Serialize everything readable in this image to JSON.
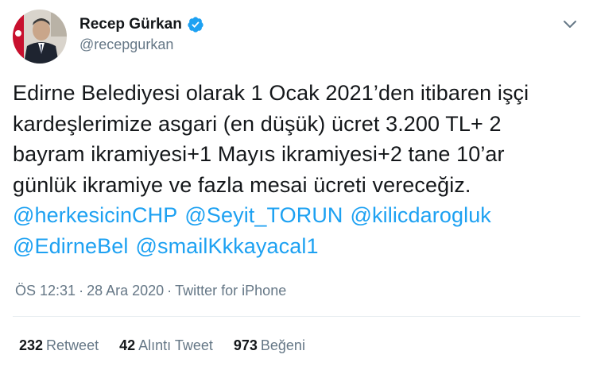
{
  "author": {
    "display_name": "Recep Gürkan",
    "handle": "@recepgurkan",
    "verified": true,
    "verified_color": "#1da1f2"
  },
  "tweet": {
    "lines": [
      "Edirne Belediyesi olarak 1 Ocak 2021’den itibaren işçi",
      "kardeşlerimize asgari (en düşük) ücret 3.200 TL+ 2",
      "bayram ikramiyesi+1 Mayıs ikramiyesi+2 tane 10’ar",
      "günlük ikramiye ve fazla mesai ücreti vereceğiz."
    ],
    "mentions_line1": [
      "@herkesicinCHP",
      "@Seyit_TORUN",
      "@kilicdarogluk"
    ],
    "mentions_line2": [
      "@EdirneBel",
      "@smailKkkayacal1"
    ]
  },
  "meta": {
    "time": "ÖS 12:31",
    "separator": "·",
    "date": "28 Ara 2020",
    "source": "Twitter for iPhone"
  },
  "stats": {
    "retweets": {
      "count": "232",
      "label": "Retweet"
    },
    "quotes": {
      "count": "42",
      "label": "Alıntı Tweet"
    },
    "likes": {
      "count": "973",
      "label": "Beğeni"
    }
  },
  "colors": {
    "link": "#1da1f2",
    "secondary_text": "#657786",
    "divider": "#e6ecf0"
  },
  "icons": {
    "verified": "verified-badge-icon",
    "menu": "chevron-down-icon"
  }
}
